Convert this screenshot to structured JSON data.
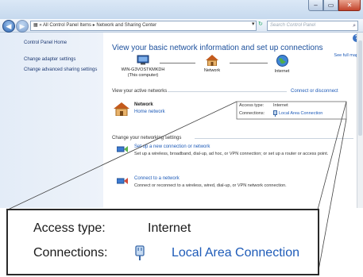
{
  "window": {
    "caption_buttons": {
      "minimize": "–",
      "maximize": "▭",
      "close": "✕"
    },
    "back_arrow": "◀",
    "forward_arrow": "▶",
    "address": "▦ « All Control Panel Items ▸ Network and Sharing Center",
    "address_dropdown": "▾",
    "refresh_icon": "↻",
    "search_placeholder": "Search Control Panel",
    "search_icon": "⌕"
  },
  "left_pane": {
    "home": "Control Panel Home",
    "items": [
      "Change adapter settings",
      "Change advanced sharing settings"
    ]
  },
  "main": {
    "help_icon": "?",
    "heading": "View your basic network information and set up connections",
    "see_full_map": "See full map",
    "map_nodes": [
      {
        "label": "WIN-G3VOSTKMKDH\n(This computer)",
        "icon": "computer-icon"
      },
      {
        "label": "Network",
        "icon": "house-icon"
      },
      {
        "label": "Internet",
        "icon": "globe-icon"
      }
    ],
    "active_networks_label": "View your active networks",
    "connect_disconnect": "Connect or disconnect",
    "network": {
      "name": "Network",
      "type": "Home network"
    },
    "access_type_label": "Access type:",
    "access_type_value": "Internet",
    "connections_label": "Connections:",
    "connections_value": "Local Area Connection",
    "change_settings_label": "Change your networking settings",
    "tasks": [
      {
        "title": "Set up a new connection or network",
        "desc": "Set up a wireless, broadband, dial-up, ad hoc, or VPN connection; or set up a router or access point."
      },
      {
        "title": "Connect to a network",
        "desc": "Connect or reconnect to a wireless, wired, dial-up, or VPN network connection."
      }
    ]
  },
  "callout": {
    "access_type_label": "Access type:",
    "access_type_value": "Internet",
    "connections_label": "Connections:",
    "connections_value": "Local Area Connection"
  },
  "colors": {
    "link": "#1e5bb8",
    "heading": "#1b4f9c",
    "left_pane": "#e3ecf7",
    "callout_border": "#2a2a2a"
  }
}
